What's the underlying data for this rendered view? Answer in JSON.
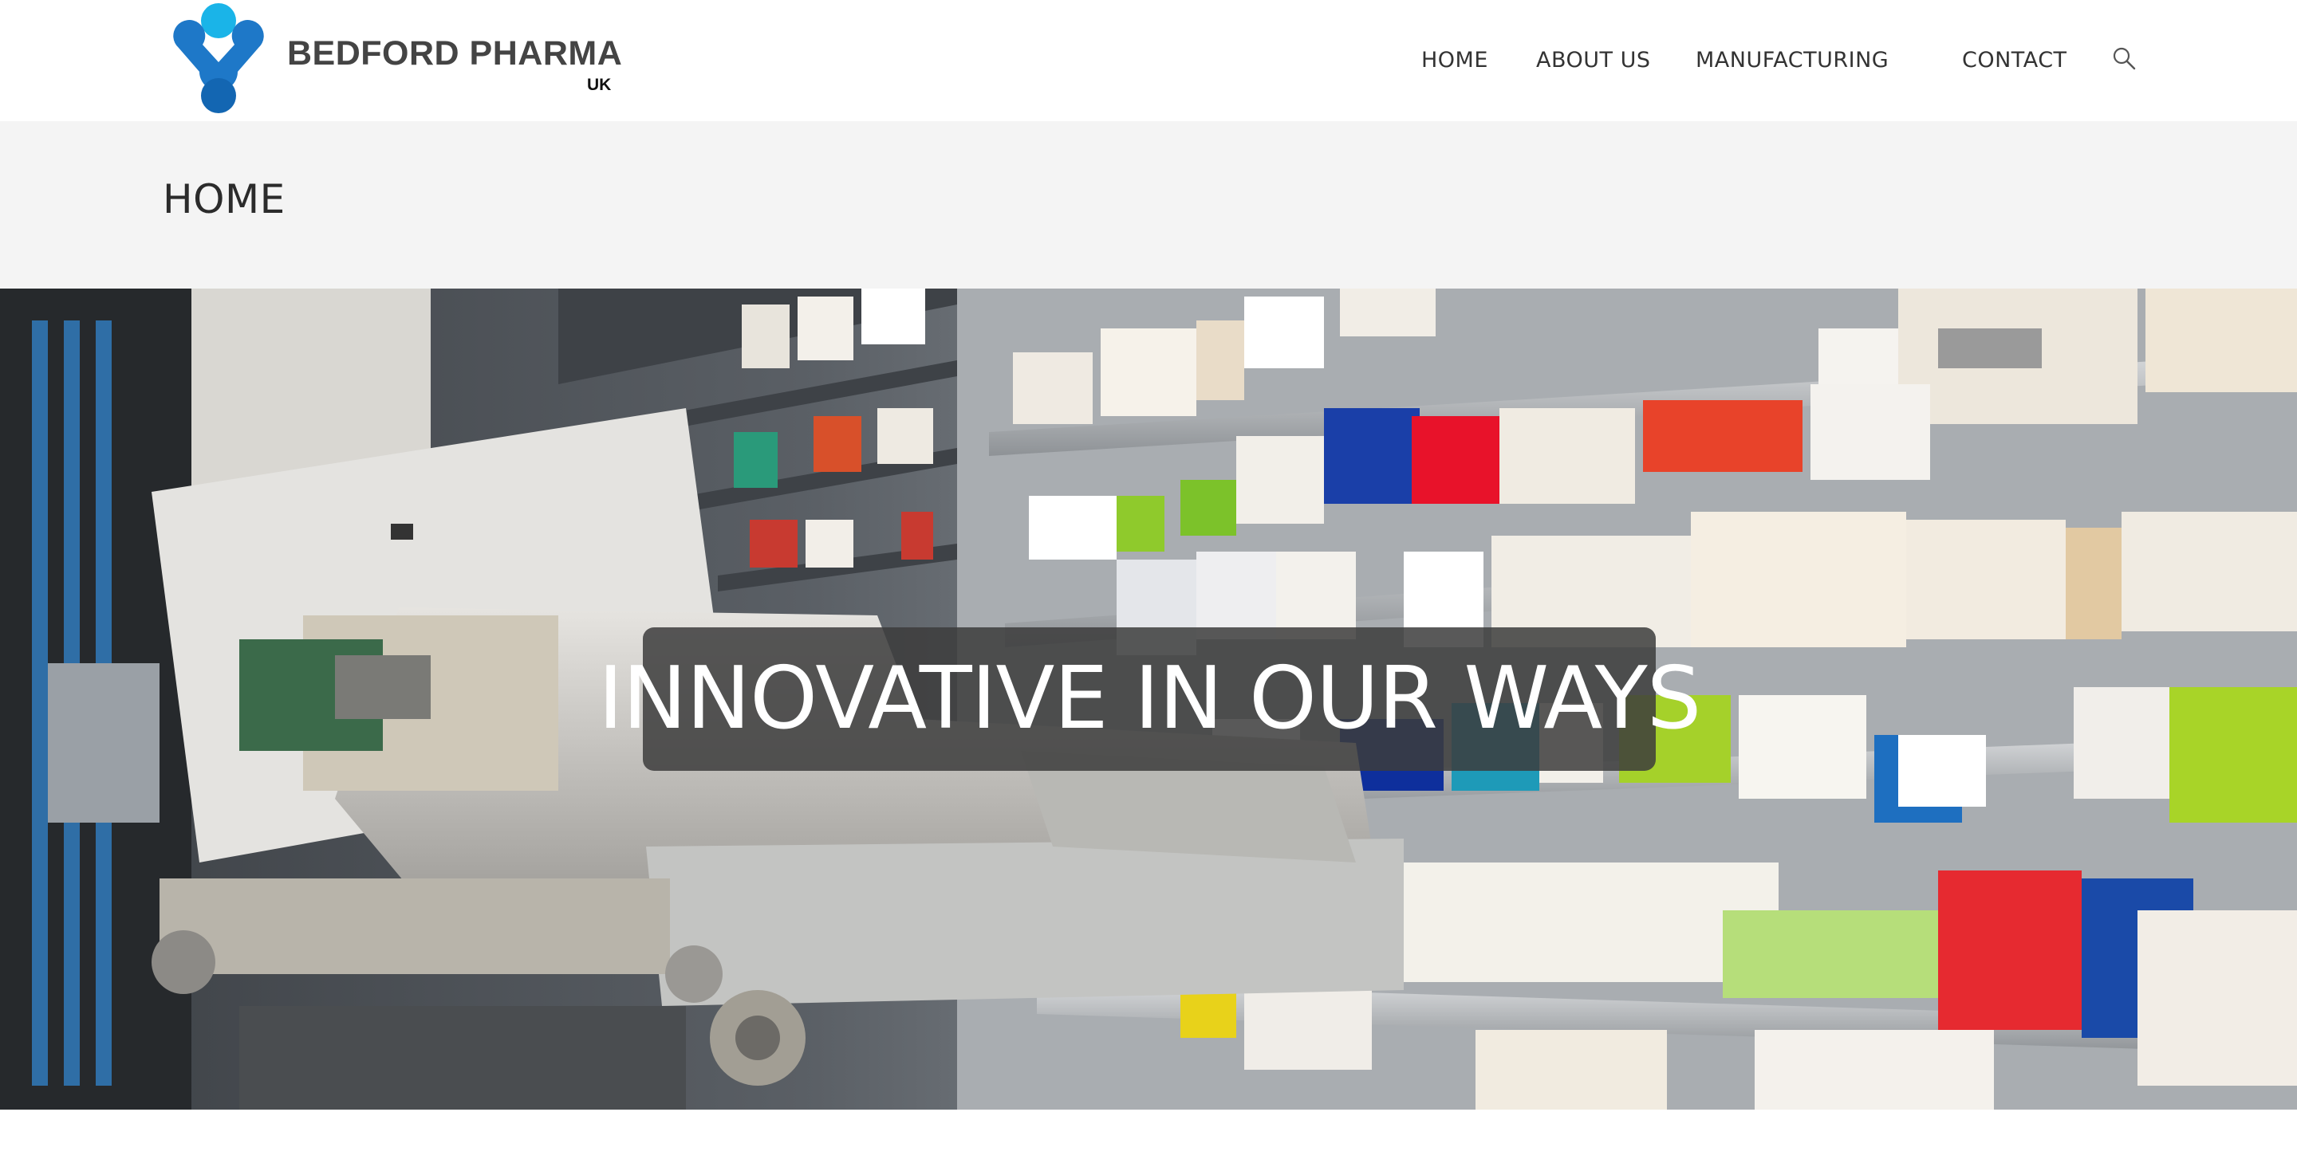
{
  "header": {
    "logo": {
      "name": "BEDFORD PHARMA",
      "sub": "UK"
    },
    "nav": [
      {
        "label": "HOME"
      },
      {
        "label": "ABOUT US"
      },
      {
        "label": "MANUFACTURING"
      },
      {
        "label": "CONTACT"
      }
    ],
    "search_icon": "search-icon"
  },
  "page": {
    "title": "HOME"
  },
  "hero": {
    "caption": "INNOVATIVE IN OUR WAYS"
  },
  "colors": {
    "logo_blue": "#1e78c8",
    "logo_cyan": "#1ab4e8",
    "band": "#f4f4f4"
  }
}
